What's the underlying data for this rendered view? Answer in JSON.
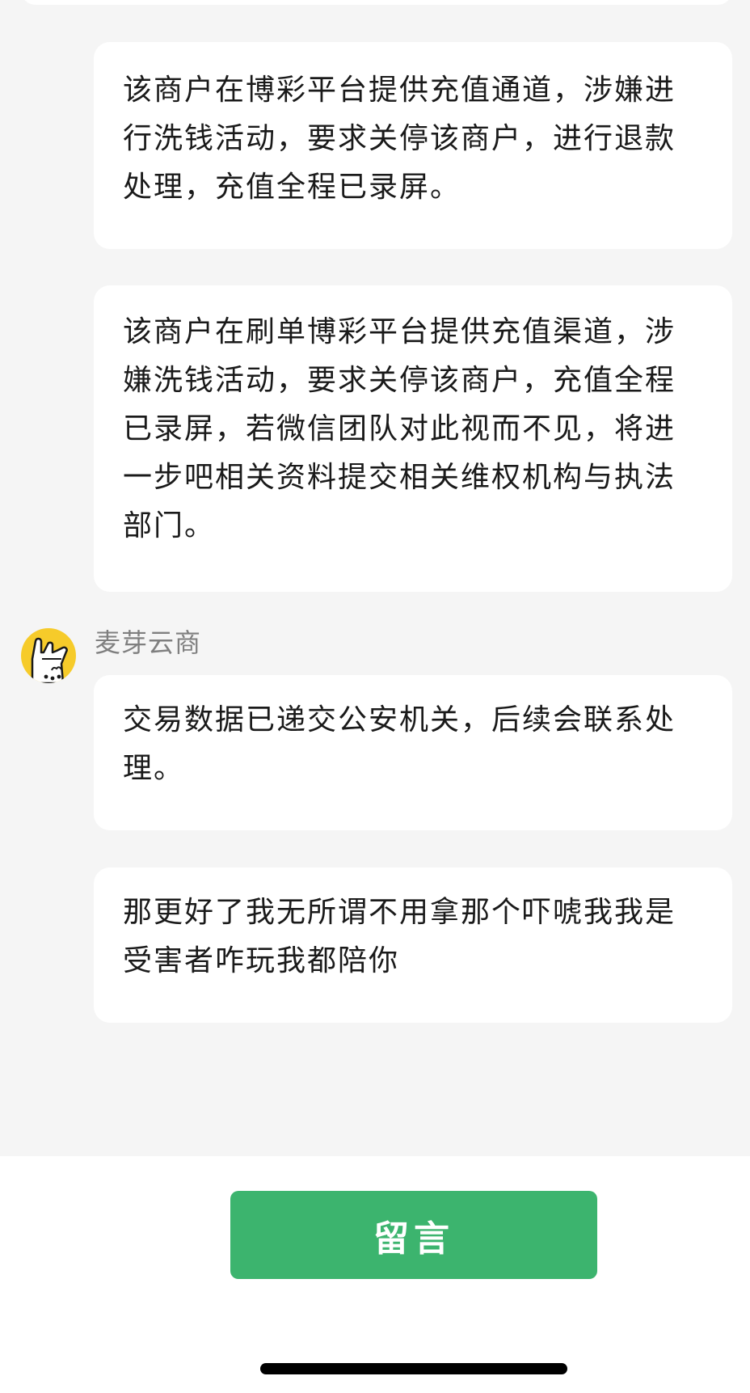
{
  "messages": [
    {
      "text": "该商户在博彩平台提供充值通道，涉嫌进行洗钱活动，要求关停该商户，进行退款处理，充值全程已录屏。"
    },
    {
      "text": "该商户在刷单博彩平台提供充值渠道，涉嫌洗钱活动，要求关停该商户，充值全程已录屏，若微信团队对此视而不见，将进一步吧相关资料提交相关维权机构与执法部门。"
    },
    {
      "sender": "麦芽云商",
      "text": "交易数据已递交公安机关，后续会联系处理。"
    },
    {
      "text": "那更好了我无所谓不用拿那个吓唬我我是受害者咋玩我都陪你"
    }
  ],
  "footer": {
    "button_label": "留言"
  },
  "colors": {
    "background": "#f5f5f5",
    "bubble": "#ffffff",
    "accent_green": "#3cb46e",
    "avatar_yellow": "#f6cb2a",
    "sender_gray": "#7f7f7f"
  },
  "icons": {
    "avatar": "rock-hand-avatar-icon"
  }
}
